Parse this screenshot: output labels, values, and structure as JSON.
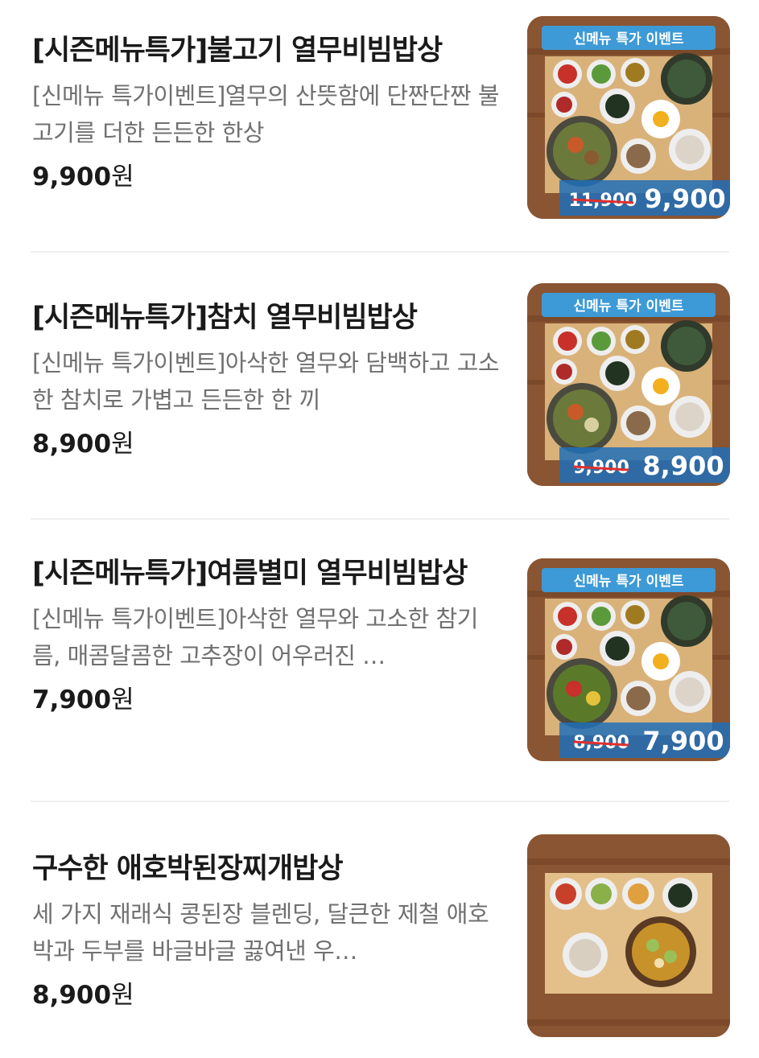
{
  "items": [
    {
      "title": "[시즌메뉴특가]불고기 열무비빔밥상",
      "desc": "[신메뉴 특가이벤트]열무의 산뜻함에 단짠단짠 불고기를 더한 든든한 한상",
      "price": "9,900",
      "currency": "원",
      "image": {
        "banner": "신메뉴 특가 이벤트",
        "old_price": "11,900",
        "new_price": "9,900"
      }
    },
    {
      "title": "[시즌메뉴특가]참치 열무비빔밥상",
      "desc": "[신메뉴 특가이벤트]아삭한 열무와 담백하고 고소한 참치로 가볍고 든든한 한 끼",
      "price": "8,900",
      "currency": "원",
      "image": {
        "banner": "신메뉴 특가 이벤트",
        "old_price": "9,900",
        "new_price": "8,900"
      }
    },
    {
      "title": "[시즌메뉴특가]여름별미 열무비빔밥상",
      "desc": "[신메뉴 특가이벤트]아삭한 열무와 고소한 참기름, 매콤달콤한 고추장이 어우러진 …",
      "price": "7,900",
      "currency": "원",
      "image": {
        "banner": "신메뉴 특가 이벤트",
        "old_price": "8,900",
        "new_price": "7,900"
      }
    },
    {
      "title": "구수한 애호박된장찌개밥상",
      "desc": "세 가지 재래식 콩된장 블렌딩, 달큰한 제철 애호박과 두부를 바글바글 끓여낸 우…",
      "price": "8,900",
      "currency": "원"
    }
  ],
  "colors": {
    "banner_blue": "#3d9ad6",
    "price_bar_blue": "#1f6fb8",
    "strike_red": "#e0302e",
    "wood": "#7a4a2a",
    "tray": "#d9b27a"
  }
}
